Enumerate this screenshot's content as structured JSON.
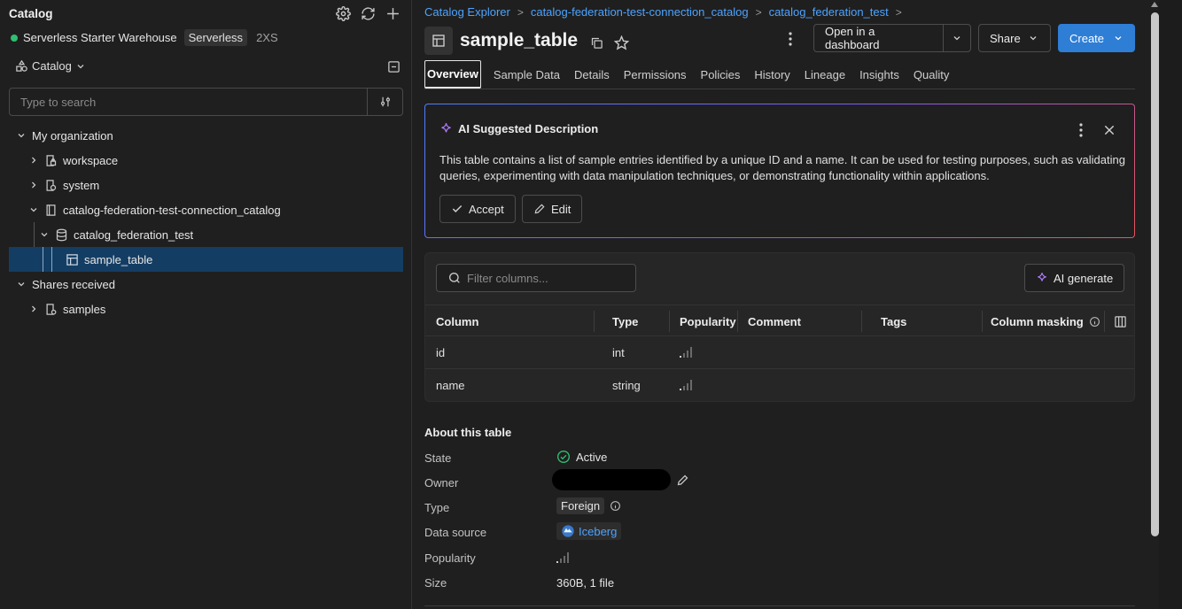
{
  "sidebar": {
    "title": "Catalog",
    "warehouse": {
      "name": "Serverless Starter Warehouse",
      "badge": "Serverless",
      "size": "2XS",
      "status_color": "#2fbf71"
    },
    "catalog_selector": "Catalog",
    "search_placeholder": "Type to search",
    "tree": {
      "my_org": "My organization",
      "workspace": "workspace",
      "system": "system",
      "fed_catalog": "catalog-federation-test-connection_catalog",
      "fed_schema": "catalog_federation_test",
      "sample_table": "sample_table",
      "shares": "Shares received",
      "samples": "samples"
    }
  },
  "breadcrumb": {
    "items": [
      "Catalog Explorer",
      "catalog-federation-test-connection_catalog",
      "catalog_federation_test"
    ],
    "separator": ">"
  },
  "header": {
    "title": "sample_table",
    "open_dashboard": "Open in a dashboard",
    "share": "Share",
    "create": "Create"
  },
  "tabs": [
    "Overview",
    "Sample Data",
    "Details",
    "Permissions",
    "Policies",
    "History",
    "Lineage",
    "Insights",
    "Quality"
  ],
  "ai_card": {
    "title": "AI Suggested Description",
    "text": "This table contains a list of sample entries identified by a unique ID and a name. It can be used for testing purposes, such as validating queries, experimenting with data manipulation techniques, or demonstrating functionality within applications.",
    "accept": "Accept",
    "edit": "Edit"
  },
  "columns_panel": {
    "filter_placeholder": "Filter columns...",
    "ai_generate": "AI generate",
    "headers": [
      "Column",
      "Type",
      "Popularity",
      "Comment",
      "Tags",
      "Column masking"
    ],
    "rows": [
      {
        "column": "id",
        "type": "int"
      },
      {
        "column": "name",
        "type": "string"
      }
    ]
  },
  "about": {
    "title": "About this table",
    "labels": [
      "State",
      "Owner",
      "Type",
      "Data source",
      "Popularity",
      "Size"
    ],
    "state": "Active",
    "type": "Foreign",
    "data_source": "Iceberg",
    "size": "360B, 1 file"
  },
  "colors": {
    "accent": "#2e7ed6",
    "link": "#4da3ff",
    "selected": "#143d63",
    "success": "#2fbf71"
  }
}
